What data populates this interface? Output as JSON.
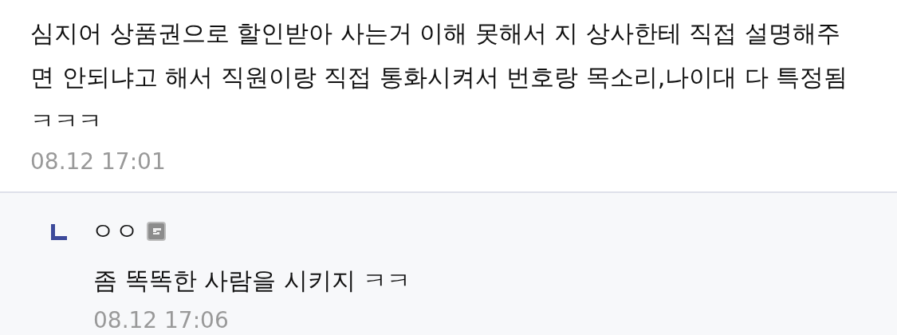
{
  "comment": {
    "text": "심지어 상품권으로 할인받아 사는거 이해 못해서 지 상사한테 직접 설명해주면 안되냐고 해서 직원이랑 직접 통화시켜서 번호랑 목소리,나이대 다 특정됨ㅋㅋㅋ",
    "time": "08.12 17:01"
  },
  "reply": {
    "author": "ㅇㅇ",
    "text": "좀 똑똑한 사람을 시키지 ㅋㅋ",
    "time": "08.12 17:06"
  }
}
